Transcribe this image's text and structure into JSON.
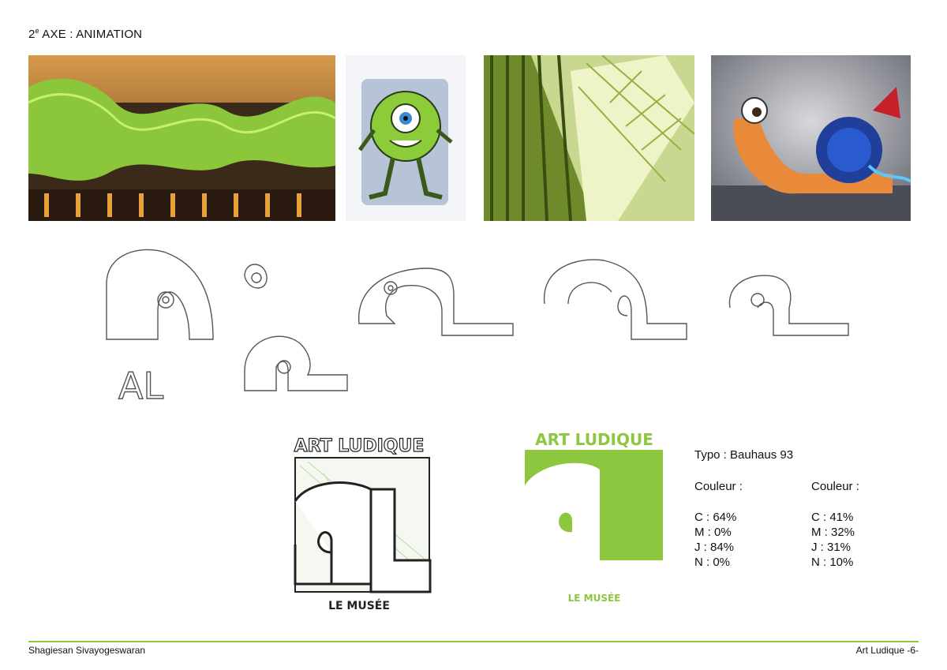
{
  "page": {
    "title_prefix": "2",
    "title_sup": "e",
    "title_rest": " AXE : ANIMATION"
  },
  "images": [
    {
      "name": "les-docks-green-building-photo"
    },
    {
      "name": "mike-wazowski-sketch"
    },
    {
      "name": "green-building-interior-photo"
    },
    {
      "name": "turbo-snail-photo"
    }
  ],
  "sketch_labels": {
    "al": "AL"
  },
  "logos": {
    "sketch": {
      "top_text": "ART LUDIQUE",
      "bottom_text": "LE MUSÉE"
    },
    "final": {
      "top_text": "ART LUDIQUE",
      "bottom_text": "LE MUSÉE",
      "accent": "#8dc63f"
    }
  },
  "specs": {
    "typo": "Typo : Bauhaus 93",
    "colors": [
      {
        "label": "Couleur :",
        "values": [
          "C : 64%",
          "M : 0%",
          "J : 84%",
          "N : 0%"
        ]
      },
      {
        "label": "Couleur :",
        "values": [
          "C : 41%",
          "M : 32%",
          "J : 31%",
          "N : 10%"
        ]
      }
    ]
  },
  "footer": {
    "author": "Shagiesan Sivayogeswaran",
    "page_label": "Art Ludique -6-"
  },
  "colors": {
    "brand_green": "#8dc63f",
    "footer_line": "#8dc63f"
  }
}
